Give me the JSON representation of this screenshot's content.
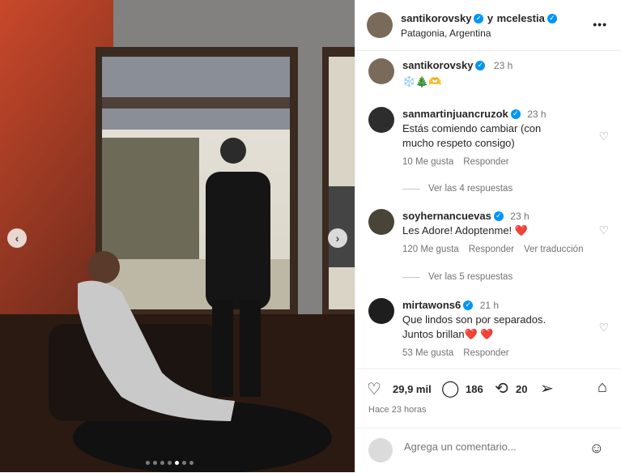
{
  "header": {
    "user1": "santikorovsky",
    "joiner": "y",
    "user2": "mcelestia",
    "location": "Patagonia, Argentina",
    "more_label": "•••"
  },
  "caption": {
    "username": "santikorovsky",
    "time": "23 h",
    "text": "❄️🎄🫶"
  },
  "comments": [
    {
      "username": "sanmartinjuancruzok",
      "time": "23 h",
      "text": "Estás comiendo cambiar (con mucho respeto consigo)",
      "likes": "10 Me gusta",
      "reply": "Responder",
      "translate": "",
      "replies": "Ver las 4 respuestas"
    },
    {
      "username": "soyhernancuevas",
      "time": "23 h",
      "text": "Les Adore! Adoptenme! ❤️",
      "likes": "120 Me gusta",
      "reply": "Responder",
      "translate": "Ver traducción",
      "replies": "Ver las 5 respuestas"
    },
    {
      "username": "mirtawons6",
      "time": "21 h",
      "text": "Que lindos son por separados. Juntos brillan❤️ ❤️",
      "likes": "53 Me gusta",
      "reply": "Responder",
      "translate": "",
      "replies": ""
    }
  ],
  "actions": {
    "likes": "29,9 mil",
    "comments": "186",
    "reposts": "20",
    "timestamp": "Hace 23 horas"
  },
  "add_comment": {
    "placeholder": "Agrega un comentario..."
  },
  "carousel": {
    "count": 7,
    "active": 4
  },
  "colors": {
    "accent": "#0095f6",
    "heart": "#ed4956",
    "muted": "#737373"
  }
}
